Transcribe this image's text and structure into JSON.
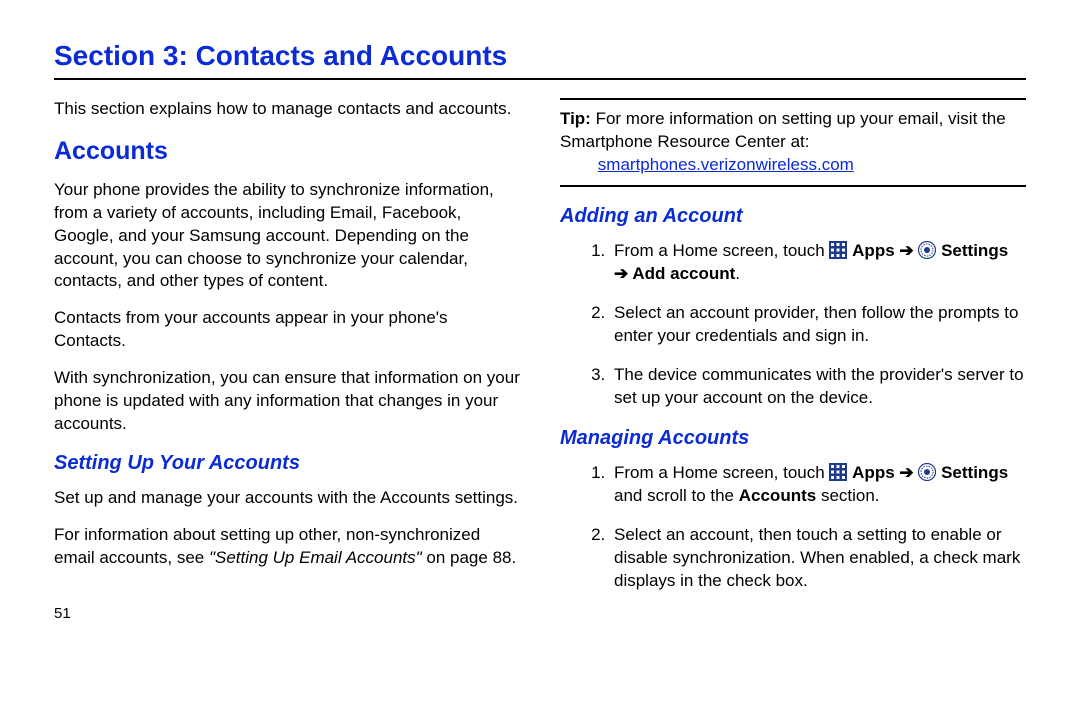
{
  "section_title": "Section 3: Contacts and Accounts",
  "intro": "This section explains how to manage contacts and accounts.",
  "left": {
    "heading_accounts": "Accounts",
    "p1": "Your phone provides the ability to synchronize information, from a variety of accounts, including Email, Facebook, Google, and your Samsung account. Depending on the account, you can choose to synchronize your calendar, contacts, and other types of content.",
    "p2": "Contacts from your accounts appear in your phone's Contacts.",
    "p3": "With synchronization, you can ensure that information on your phone is updated with any information that changes in your accounts.",
    "heading_setting_up": "Setting Up Your Accounts",
    "p4": "Set up and manage your accounts with the Accounts settings.",
    "p5_a": "For information about setting up other, non-synchronized email accounts, see ",
    "p5_xref": "\"Setting Up Email Accounts\"",
    "p5_b": " on page 88."
  },
  "right": {
    "tip_label": "Tip:",
    "tip_text": " For more information on setting up your email, visit the Smartphone Resource Center at:",
    "tip_link": "smartphones.verizonwireless.com",
    "heading_adding": "Adding an Account",
    "add1_a": "From a Home screen, touch ",
    "label_apps": "Apps",
    "arrow": " ➔ ",
    "label_settings": "Settings",
    "label_add_account": "Add account",
    "add1_d": ".",
    "add2": "Select an account provider, then follow the prompts to enter your credentials and sign in.",
    "add3": "The device communicates with the provider's server to set up your account on the device.",
    "heading_managing": "Managing Accounts",
    "mng1_a": "From a Home screen, touch ",
    "mng1_tail": " and scroll to the ",
    "mng1_b": "Accounts",
    "mng1_c": " section.",
    "mng2": "Select an account, then touch a setting to enable or disable synchronization. When enabled, a check mark displays in the check box."
  },
  "page_number": "51"
}
